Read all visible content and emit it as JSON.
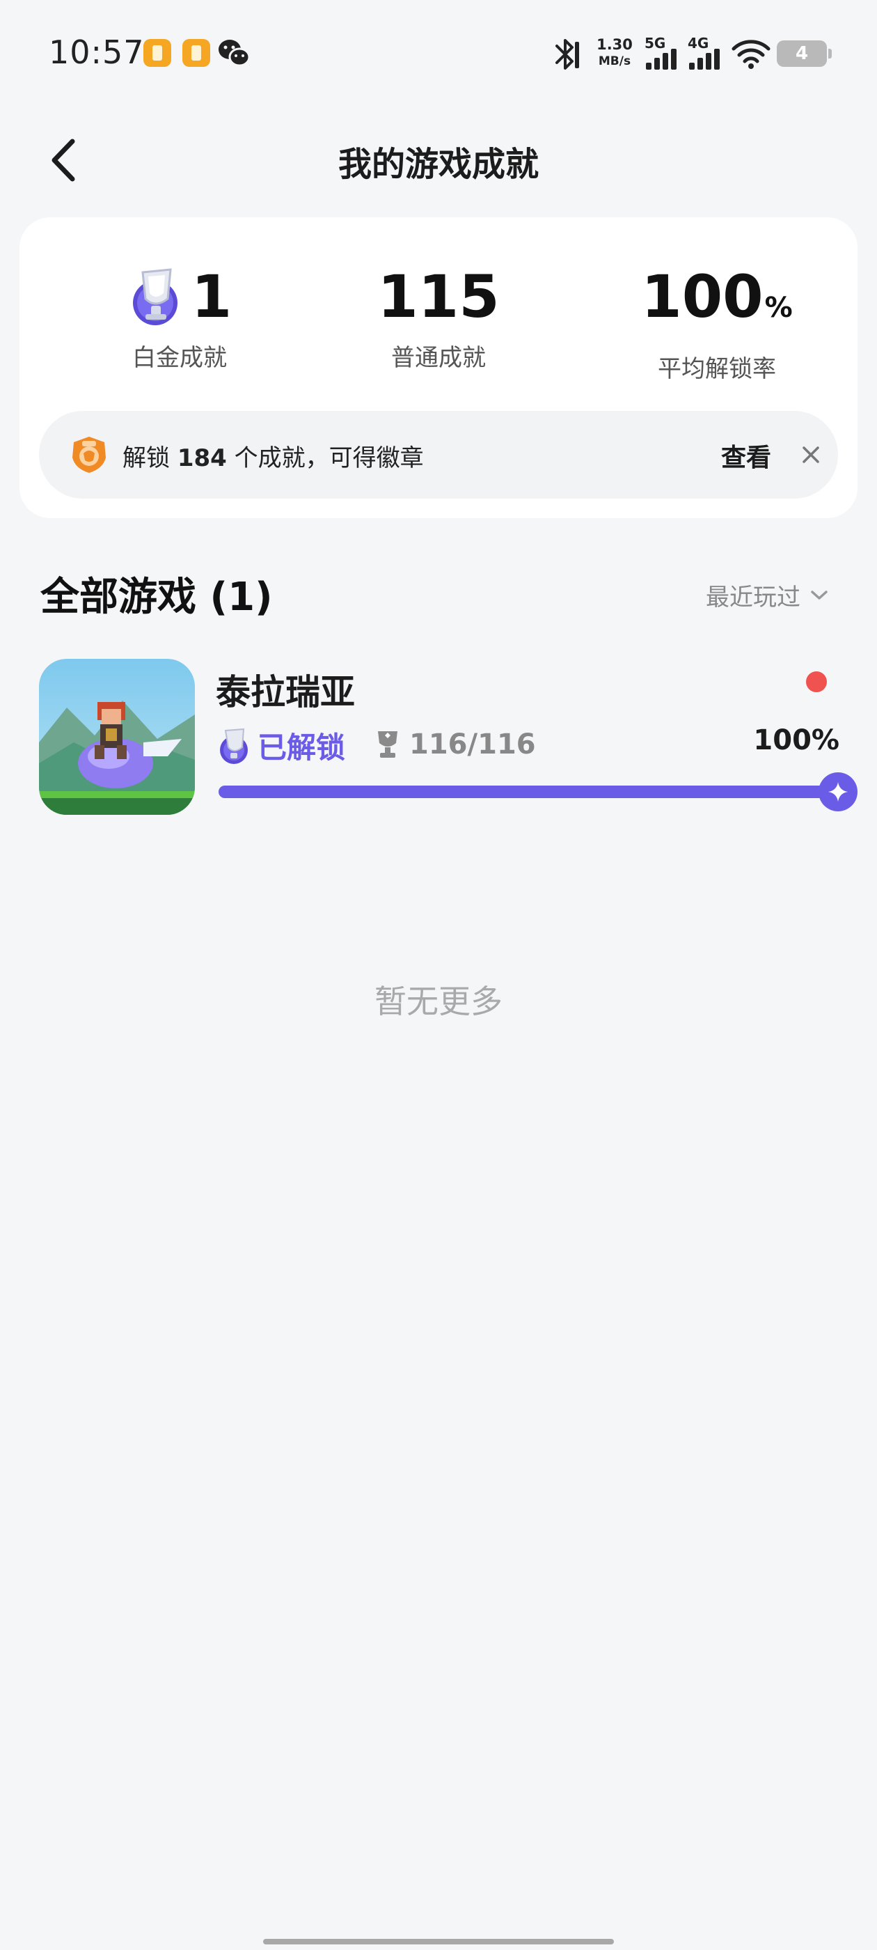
{
  "status_bar": {
    "time": "10:57",
    "net_speed_value": "1.30",
    "net_speed_unit": "MB/s",
    "sim1_label": "5G",
    "sim2_label": "4G",
    "battery": "4",
    "icons": [
      "notification-app-icon",
      "notification-app-icon",
      "wechat-icon",
      "bluetooth-icon",
      "signal-icon",
      "signal-icon",
      "wifi-icon",
      "battery-icon"
    ]
  },
  "header": {
    "title": "我的游戏成就",
    "back_icon": "chevron-left-icon"
  },
  "summary": {
    "stats": [
      {
        "value": "1",
        "unit": "",
        "label": "白金成就"
      },
      {
        "value": "115",
        "unit": "",
        "label": "普通成就"
      },
      {
        "value": "100",
        "unit": "%",
        "label": "平均解锁率"
      }
    ],
    "banner": {
      "text_prefix": "解锁 ",
      "count": "184",
      "text_suffix": " 个成就，可得徽章",
      "action_label": "查看"
    }
  },
  "games_section": {
    "title": "全部游戏 (1)",
    "sort_label": "最近玩过",
    "games": [
      {
        "name": "泰拉瑞亚",
        "status_label": "已解锁",
        "achievements": "116/116",
        "percent_label": "100%",
        "progress": 1.0,
        "has_new": true
      }
    ],
    "empty_text": "暂无更多"
  },
  "colors": {
    "accent": "#6b5ce7",
    "background": "#f5f6f8",
    "card": "#ffffff",
    "new_dot": "#f0524f",
    "badge_orange": "#f08a24"
  }
}
